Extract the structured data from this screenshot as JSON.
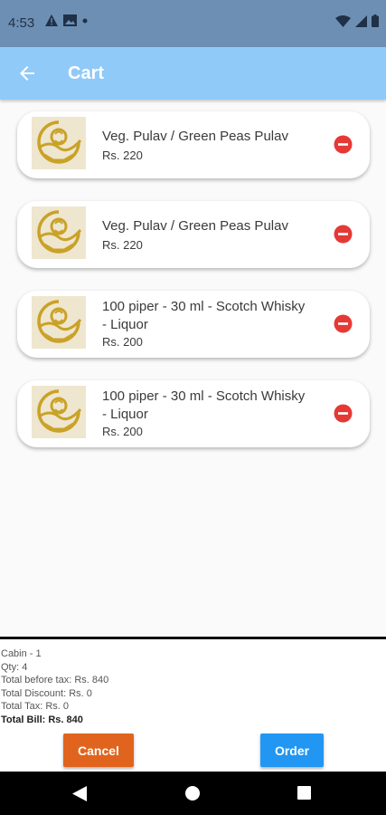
{
  "status_bar": {
    "time": "4:53"
  },
  "app_bar": {
    "title": "Cart"
  },
  "cart_items": [
    {
      "name": "Veg. Pulav / Green Peas Pulav",
      "price": "Rs. 220"
    },
    {
      "name": "Veg. Pulav / Green Peas Pulav",
      "price": "Rs. 220"
    },
    {
      "name": "100 piper - 30 ml - Scotch Whisky - Liquor",
      "price": "Rs. 200"
    },
    {
      "name": "100 piper - 30 ml - Scotch Whisky - Liquor",
      "price": "Rs. 200"
    }
  ],
  "summary": {
    "cabin": "Cabin - 1",
    "qty": "Qty: 4",
    "total_before_tax": "Total before tax: Rs. 840",
    "total_discount": "Total Discount: Rs. 0",
    "total_tax": "Total Tax: Rs. 0",
    "total_bill": "Total Bill: Rs. 840"
  },
  "actions": {
    "cancel_label": "Cancel",
    "order_label": "Order"
  },
  "colors": {
    "app_bar": "#90caf9",
    "status_bar": "#6d8fb3",
    "cancel": "#e0641e",
    "order": "#2196f3",
    "remove": "#e53935",
    "logo_gold": "#c9a227"
  }
}
